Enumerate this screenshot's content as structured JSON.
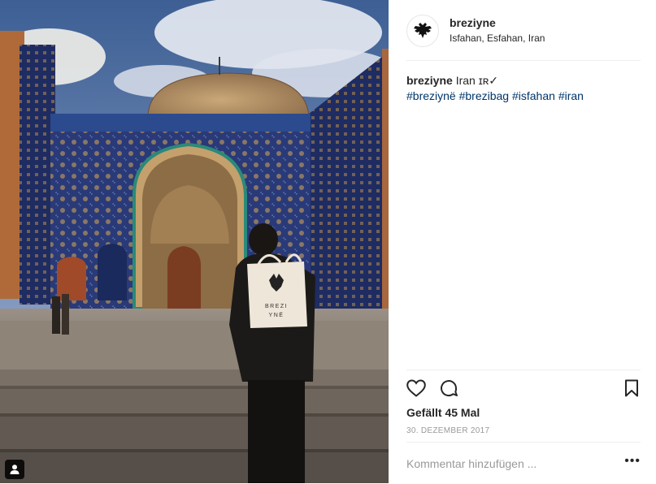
{
  "post": {
    "username": "breziyne",
    "location": "Isfahan, Esfahan, Iran",
    "caption_user": "breziyne",
    "caption_text": "Iran ɪʀ✓",
    "hashtags": [
      "#breziynë",
      "#brezibag",
      "#isfahan",
      "#iran"
    ],
    "likes_text": "Gefällt 45 Mal",
    "date": "30. DEZEMBER 2017",
    "comment_placeholder": "Kommentar hinzufügen ...",
    "more_label": "•••"
  },
  "bag_print": {
    "line1": "BREZI",
    "line2": "YNË"
  },
  "icons": {
    "like": "heart-icon",
    "comment": "comment-bubble-icon",
    "save": "bookmark-icon",
    "user_tag": "person-icon",
    "avatar": "double-headed-eagle-icon"
  },
  "colors": {
    "text": "#262626",
    "secondary": "#999999",
    "hashtag": "#003569",
    "divider": "#efefef"
  }
}
